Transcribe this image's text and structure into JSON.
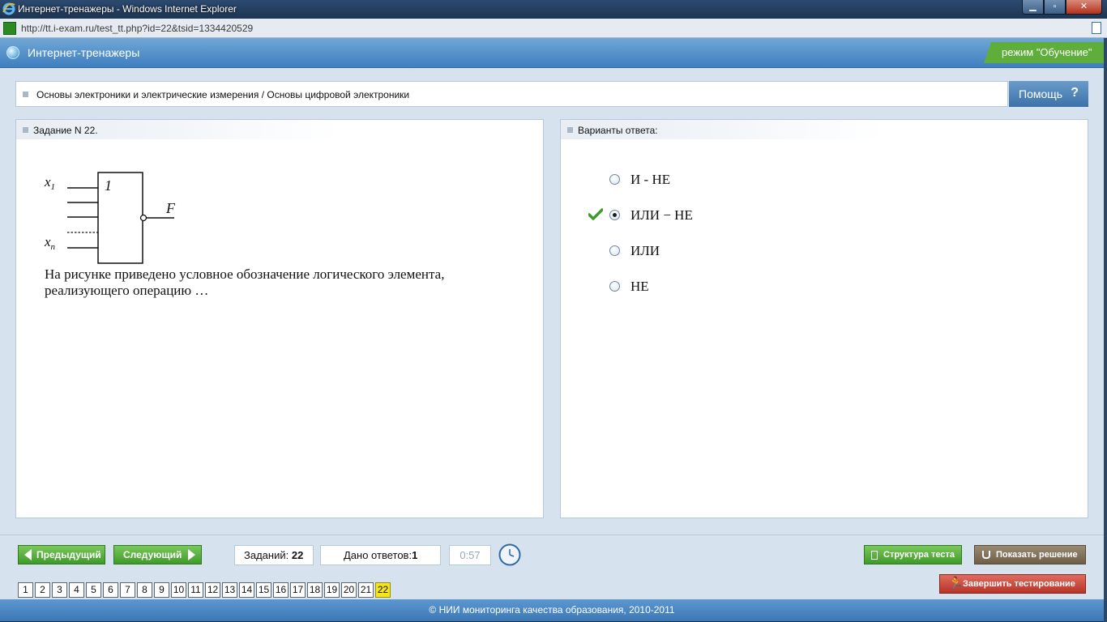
{
  "window": {
    "title": "Интернет-тренажеры - Windows Internet Explorer",
    "url": "http://tt.i-exam.ru/test_tt.php?id=22&tsid=1334420529"
  },
  "header": {
    "app_title": "Интернет-тренажеры",
    "mode": "режим \"Обучение\""
  },
  "breadcrumb": "Основы электроники и электрические измерения / Основы цифровой электроники",
  "help_label": "Помощь",
  "task": {
    "title": "Задание N 22.",
    "question": "На рисунке приведено условное обозначение логического элемента, реализующего операцию …",
    "diagram": {
      "gate_label": "1",
      "input_first": "x",
      "input_first_sub": "1",
      "input_last": "x",
      "input_last_sub": "n",
      "output": "F"
    }
  },
  "answers": {
    "title": "Варианты ответа:",
    "options": [
      {
        "label": "И - НЕ",
        "selected": false
      },
      {
        "label": "ИЛИ − НЕ",
        "selected": true
      },
      {
        "label": "ИЛИ",
        "selected": false
      },
      {
        "label": "НЕ",
        "selected": false
      }
    ]
  },
  "nav": {
    "prev": "Предыдущий",
    "next": "Следующий",
    "tasks_label": "Заданий:",
    "tasks_count": "22",
    "answers_label": "Дано ответов:",
    "answers_count": "1",
    "timer": "0:57",
    "structure": "Структура теста",
    "show_solution": "Показать решение",
    "finish": "Завершить тестирование",
    "pages": [
      "1",
      "2",
      "3",
      "4",
      "5",
      "6",
      "7",
      "8",
      "9",
      "10",
      "11",
      "12",
      "13",
      "14",
      "15",
      "16",
      "17",
      "18",
      "19",
      "20",
      "21",
      "22"
    ],
    "current_page": "22"
  },
  "footer": "© НИИ мониторинга качества образования, 2010-2011",
  "colors": {
    "header_blue": "#4d8cc8",
    "mode_green": "#5fae3b",
    "nav_green": "#4fa836",
    "finish_red": "#c9443a",
    "solution_brown": "#7f6d54",
    "current_page_yellow": "#f5e51a"
  }
}
